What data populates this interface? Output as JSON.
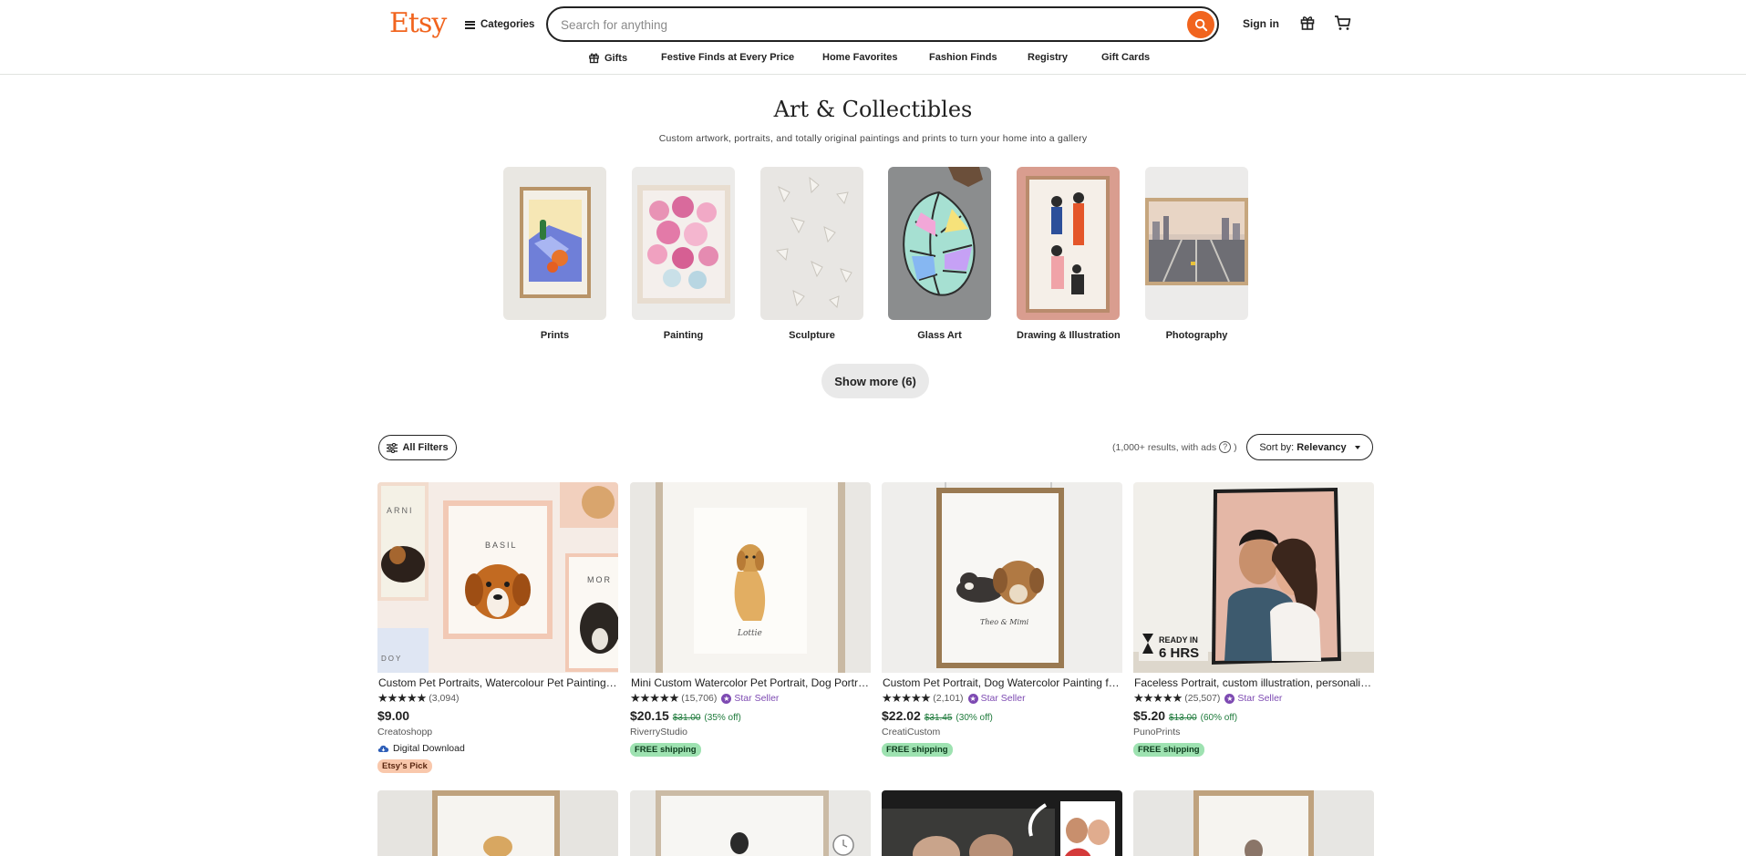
{
  "header": {
    "logo": "Etsy",
    "categories_label": "Categories",
    "search_placeholder": "Search for anything",
    "signin_label": "Sign in"
  },
  "nav": [
    {
      "label": "Gifts",
      "icon": "gift-icon"
    },
    {
      "label": "Festive Finds at Every Price"
    },
    {
      "label": "Home Favorites"
    },
    {
      "label": "Fashion Finds"
    },
    {
      "label": "Registry"
    },
    {
      "label": "Gift Cards"
    }
  ],
  "hero": {
    "title": "Art & Collectibles",
    "subtitle": "Custom artwork, portraits, and totally original paintings and prints to turn your home into a gallery"
  },
  "categories": [
    {
      "label": "Prints"
    },
    {
      "label": "Painting"
    },
    {
      "label": "Sculpture"
    },
    {
      "label": "Glass Art"
    },
    {
      "label": "Drawing & Illustration"
    },
    {
      "label": "Photography"
    }
  ],
  "show_more_label": "Show more (6)",
  "toolbar": {
    "filters_label": "All Filters",
    "results_text": "(1,000+ results, with ads",
    "results_help": "?",
    "results_close": ")",
    "sort_prefix": "Sort by:",
    "sort_value": "Relevancy"
  },
  "listings": [
    {
      "title": "Custom Pet Portraits, Watercolour Pet Painting, Pet Portrait Print",
      "stars": "★★★★★",
      "reviews": "(3,094)",
      "star_seller": "",
      "price": "$9.00",
      "original_price": "",
      "discount": "",
      "shop": "Creatoshopp",
      "digital": "Digital Download",
      "badge": "Etsy's Pick"
    },
    {
      "title": "Mini Custom Watercolor Pet Portrait, Dog Portrait, Pet Memorial Gift",
      "stars": "★★★★★",
      "reviews": "(15,706)",
      "star_seller": "Star Seller",
      "price": "$20.15",
      "original_price": "$31.00",
      "discount": "(35% off)",
      "shop": "RiverryStudio",
      "digital": "",
      "badge": "FREE shipping"
    },
    {
      "title": "Custom Pet Portrait, Dog Watercolor Painting from Photo, Pet Memorial",
      "stars": "★★★★★",
      "reviews": "(2,101)",
      "star_seller": "Star Seller",
      "price": "$22.02",
      "original_price": "$31.45",
      "discount": "(30% off)",
      "shop": "CreatiCustom",
      "digital": "",
      "badge": "FREE shipping"
    },
    {
      "title": "Faceless Portrait, custom illustration, personalized couple portrait",
      "stars": "★★★★★",
      "reviews": "(25,507)",
      "star_seller": "Star Seller",
      "price": "$5.20",
      "original_price": "$13.00",
      "discount": "(60% off)",
      "shop": "PunoPrints",
      "digital": "",
      "badge": "FREE shipping"
    }
  ],
  "listing_overlays": {
    "pet_names": [
      "ARNI",
      "BASIL",
      "MOR",
      "DOY"
    ],
    "signature_2": "Lottie",
    "signature_3": "Theo & Mimi",
    "ready_line1": "READY IN",
    "ready_line2": "6 HRS"
  },
  "colors": {
    "brand": "#f1641e",
    "star_seller": "#7d4ab2",
    "discount": "#1e7a3b",
    "free_shipping_bg": "#9ee2b1",
    "etsy_pick_bg": "#f9c8ac"
  }
}
